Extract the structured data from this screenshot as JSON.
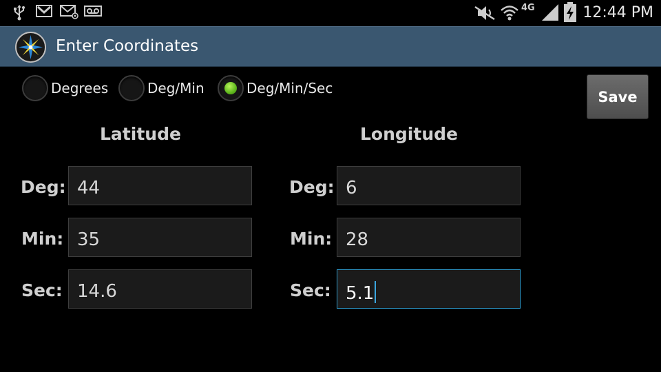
{
  "status_bar": {
    "time": "12:44 PM",
    "network_label": "4G",
    "icons": [
      "usb-icon",
      "gmail-icon",
      "email-icon",
      "voicemail-icon",
      "mute-icon",
      "wifi-icon",
      "signal-icon",
      "battery-charging-icon"
    ]
  },
  "action_bar": {
    "title": "Enter Coordinates",
    "icon": "compass-rose-icon"
  },
  "format_options": [
    {
      "label": "Degrees",
      "selected": false
    },
    {
      "label": "Deg/Min",
      "selected": false
    },
    {
      "label": "Deg/Min/Sec",
      "selected": true
    }
  ],
  "save_label": "Save",
  "latitude": {
    "header": "Latitude",
    "deg_label": "Deg:",
    "deg_value": "44",
    "min_label": "Min:",
    "min_value": "35",
    "sec_label": "Sec:",
    "sec_value": "14.6"
  },
  "longitude": {
    "header": "Longitude",
    "deg_label": "Deg:",
    "deg_value": "6",
    "min_label": "Min:",
    "min_value": "28",
    "sec_label": "Sec:",
    "sec_value": "5.1"
  },
  "colors": {
    "action_bar": "#3a5770",
    "radio_selected": "#6cc61f",
    "focus_border": "#2f9fd3"
  }
}
